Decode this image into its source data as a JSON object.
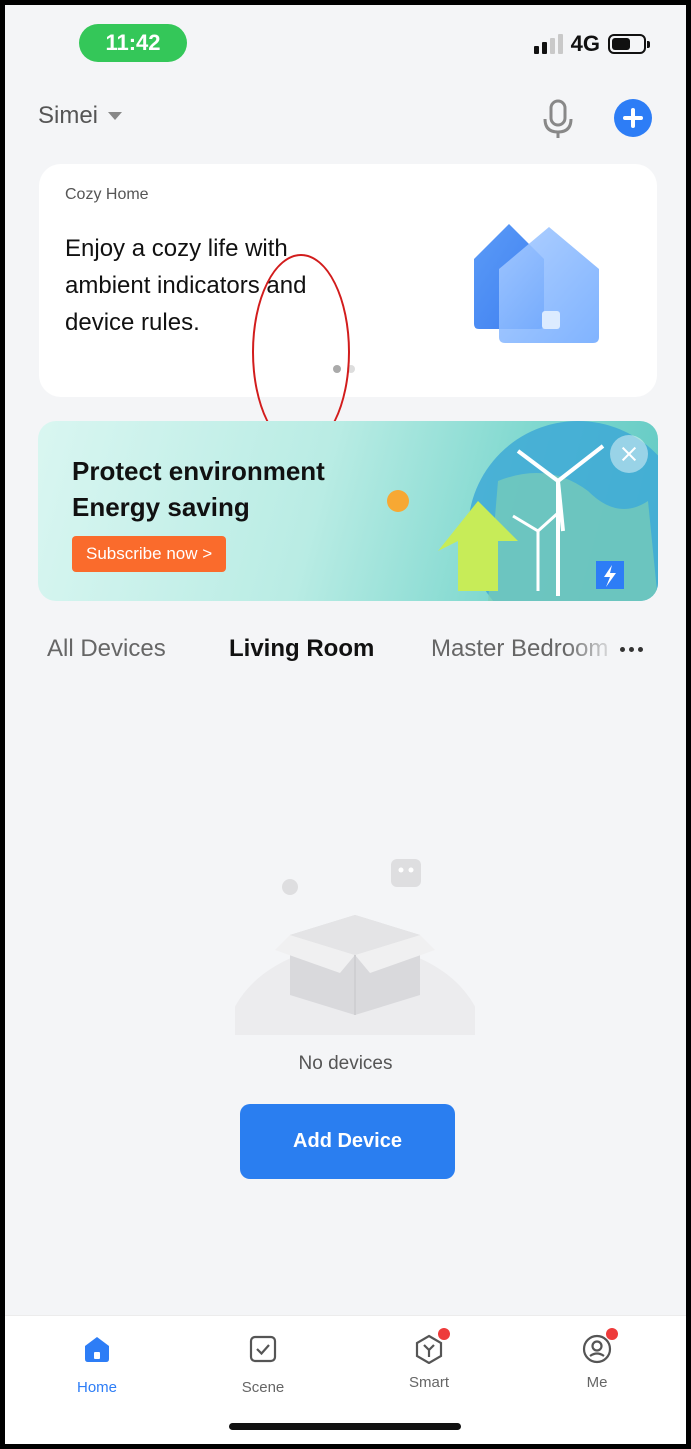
{
  "status_bar": {
    "time": "11:42",
    "network": "4G",
    "time_pill_color": "#34c759"
  },
  "header": {
    "home_name": "Simei",
    "mic_icon": "microphone-icon",
    "add_icon": "plus-circle-icon",
    "accent": "#2d7df6"
  },
  "cozy_card": {
    "label": "Cozy Home",
    "message": "Enjoy a cozy life with ambient indicators and device rules.",
    "icon": "house-icon"
  },
  "energy_banner": {
    "title_line1": "Protect environment",
    "title_line2": "Energy saving",
    "cta": "Subscribe now >",
    "cta_color": "#fa6b2c"
  },
  "room_tabs": [
    {
      "label": "All Devices",
      "active": false
    },
    {
      "label": "Living Room",
      "active": true
    },
    {
      "label": "Master Bedroom",
      "active": false
    }
  ],
  "empty_state": {
    "message": "No devices",
    "button": "Add Device"
  },
  "bottom_nav": [
    {
      "label": "Home",
      "icon": "home-icon",
      "active": true
    },
    {
      "label": "Scene",
      "icon": "checkbox-icon",
      "active": false
    },
    {
      "label": "Smart",
      "icon": "cube-icon",
      "active": false,
      "badge": true
    },
    {
      "label": "Me",
      "icon": "user-icon",
      "active": false,
      "badge": true
    }
  ]
}
